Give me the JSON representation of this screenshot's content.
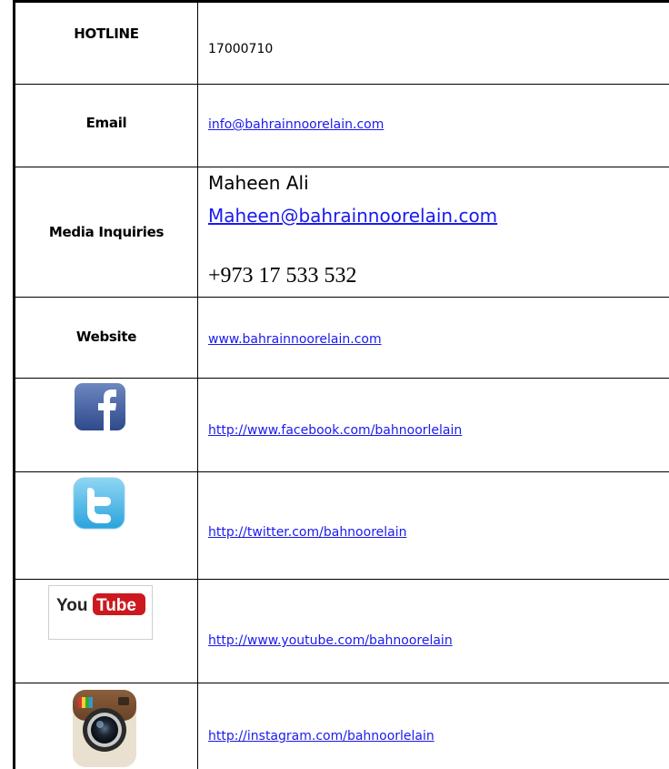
{
  "hotline": {
    "label": "HOTLINE",
    "value": "17000710"
  },
  "email": {
    "label": "Email",
    "value": "info@bahrainnoorelain.com"
  },
  "media": {
    "label": "Media Inquiries",
    "name": "Maheen Ali",
    "email": "Maheen@bahrainnoorelain.com",
    "phone": "+973 17 533 532"
  },
  "website": {
    "label": "Website",
    "value": "www.bahrainnoorelain.com"
  },
  "social": {
    "facebook": {
      "icon": "facebook-icon",
      "url": "http://www.facebook.com/bahnoorlelain"
    },
    "twitter": {
      "icon": "twitter-icon",
      "url": "http://twitter.com/bahnoorelain"
    },
    "youtube": {
      "icon": "youtube-icon",
      "url": "http://www.youtube.com/bahnoorelain",
      "logo_text_left": "You",
      "logo_text_right": "Tube"
    },
    "instagram": {
      "icon": "instagram-icon",
      "url": "http://instagram.com/bahnoorlelain"
    }
  },
  "colors": {
    "link": "#1a1aee",
    "border": "#000000",
    "facebook": "#3b5998",
    "twitter": "#3fb4e6",
    "youtube": "#cc181e"
  }
}
